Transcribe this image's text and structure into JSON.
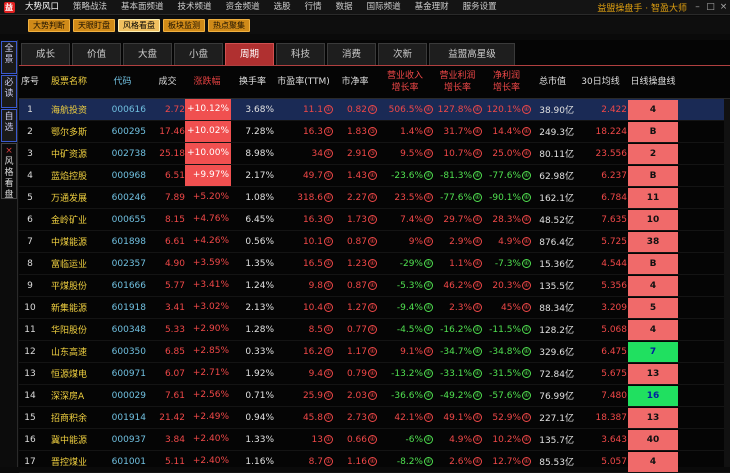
{
  "menubar": {
    "logo": "益",
    "items": [
      "大势风口",
      "策略战法",
      "基本面频道",
      "技术频道",
      "资金频道",
      "选股",
      "行情",
      "数据",
      "国际频道",
      "基金理财",
      "服务设置"
    ],
    "brand": "益盟操盘手 · 智盈大师",
    "minimize": "–",
    "maximize": "□",
    "close": "×"
  },
  "subbar": {
    "buttons": [
      "大势判断",
      "天眼盯盘",
      "风格看盘",
      "板块监测",
      "热点聚集"
    ],
    "selected_index": 2
  },
  "sidebar": {
    "tab1": "全景",
    "tab2": "必读",
    "tab3": "自选",
    "tab4_close": "×",
    "tab4": "风格看盘"
  },
  "tabs": [
    "成长",
    "价值",
    "大盘",
    "小盘",
    "周期",
    "科技",
    "消费",
    "次新",
    "益盟高星级"
  ],
  "selected_tab": 4,
  "columns": {
    "idx": "序号",
    "name": "股票名称",
    "code": "代码",
    "price": "成交",
    "change": "涨跌幅",
    "turnover": "换手率",
    "pe": "市盈率(TTM)",
    "pb": "市净率",
    "rev1": "营业收入",
    "rev2": "增长率",
    "np1": "营业利润",
    "np2": "增长率",
    "nr1": "净利润",
    "nr2": "增长率",
    "mcap": "总市值",
    "ma30": "30日均线",
    "op": "日线操盘线"
  },
  "colors": {
    "up": "#f04848",
    "down": "#50e050",
    "tab_selected": "#b03030",
    "highlight_cell": "#f05050",
    "green_box": "#20e060"
  },
  "rows": [
    {
      "idx": "1",
      "name": "海航投资",
      "code": "000616",
      "price": "2.72",
      "change": "+10.12%",
      "lim": true,
      "turnover": "3.68%",
      "pe": "11.1",
      "pe_r": "①",
      "pb": "0.82",
      "pb_r": "④",
      "rev": "506.5%",
      "rev_r": "④",
      "np": "127.8%",
      "np_r": "④",
      "nr": "120.1%",
      "nr_r": "④",
      "mcap": "38.90亿",
      "ma30": "2.422",
      "op": "4",
      "opc": "red",
      "revdn": false,
      "npdn": false,
      "nrdn": false
    },
    {
      "idx": "2",
      "name": "鄂尔多斯",
      "code": "600295",
      "price": "17.46",
      "change": "+10.02%",
      "lim": true,
      "turnover": "7.28%",
      "pe": "16.3",
      "pe_r": "①",
      "pb": "1.83",
      "pb_r": "③",
      "rev": "1.4%",
      "rev_r": "④",
      "np": "31.7%",
      "np_r": "④",
      "nr": "14.4%",
      "nr_r": "④",
      "mcap": "249.3亿",
      "ma30": "18.224",
      "op": "B",
      "opc": "red",
      "revdn": false,
      "npdn": false,
      "nrdn": false
    },
    {
      "idx": "3",
      "name": "中矿资源",
      "code": "002738",
      "price": "25.18",
      "change": "+10.00%",
      "lim": true,
      "turnover": "8.98%",
      "pe": "34",
      "pe_r": "①",
      "pb": "2.91",
      "pb_r": "③",
      "rev": "9.5%",
      "rev_r": "④",
      "np": "10.7%",
      "np_r": "④",
      "nr": "25.0%",
      "nr_r": "④",
      "mcap": "80.11亿",
      "ma30": "23.556",
      "op": "2",
      "opc": "red",
      "revdn": false,
      "npdn": false,
      "nrdn": false
    },
    {
      "idx": "4",
      "name": "蓝焰控股",
      "code": "000968",
      "price": "6.51",
      "change": "+9.97%",
      "lim": true,
      "turnover": "2.17%",
      "pe": "49.7",
      "pe_r": "①",
      "pb": "1.43",
      "pb_r": "④",
      "rev": "-23.6%",
      "rev_r": "④",
      "np": "-81.3%",
      "np_r": "④",
      "nr": "-77.6%",
      "nr_r": "④",
      "mcap": "62.98亿",
      "ma30": "6.237",
      "op": "B",
      "opc": "red",
      "revdn": true,
      "npdn": true,
      "nrdn": true
    },
    {
      "idx": "5",
      "name": "万通发展",
      "code": "600246",
      "price": "7.89",
      "change": "+5.20%",
      "lim": false,
      "turnover": "1.08%",
      "pe": "318.6",
      "pe_r": "④",
      "pb": "2.27",
      "pb_r": "④",
      "rev": "23.5%",
      "rev_r": "④",
      "np": "-77.6%",
      "np_r": "④",
      "nr": "-90.1%",
      "nr_r": "④",
      "mcap": "162.1亿",
      "ma30": "6.784",
      "op": "11",
      "opc": "red",
      "revdn": false,
      "npdn": true,
      "nrdn": true
    },
    {
      "idx": "6",
      "name": "金岭矿业",
      "code": "000655",
      "price": "8.15",
      "change": "+4.76%",
      "lim": false,
      "turnover": "6.45%",
      "pe": "16.3",
      "pe_r": "①",
      "pb": "1.73",
      "pb_r": "④",
      "rev": "7.4%",
      "rev_r": "④",
      "np": "29.7%",
      "np_r": "④",
      "nr": "28.3%",
      "nr_r": "④",
      "mcap": "48.52亿",
      "ma30": "7.635",
      "op": "10",
      "opc": "red",
      "revdn": false,
      "npdn": false,
      "nrdn": false
    },
    {
      "idx": "7",
      "name": "中煤能源",
      "code": "601898",
      "price": "6.61",
      "change": "+4.26%",
      "lim": false,
      "turnover": "0.56%",
      "pe": "10.1",
      "pe_r": "①",
      "pb": "0.87",
      "pb_r": "④",
      "rev": "9%",
      "rev_r": "④",
      "np": "2.9%",
      "np_r": "④",
      "nr": "4.9%",
      "nr_r": "④",
      "mcap": "876.4亿",
      "ma30": "5.725",
      "op": "38",
      "opc": "red",
      "revdn": false,
      "npdn": false,
      "nrdn": false
    },
    {
      "idx": "8",
      "name": "富临运业",
      "code": "002357",
      "price": "4.90",
      "change": "+3.59%",
      "lim": false,
      "turnover": "1.35%",
      "pe": "16.5",
      "pe_r": "①",
      "pb": "1.23",
      "pb_r": "④",
      "rev": "-29%",
      "rev_r": "④",
      "np": "1.1%",
      "np_r": "④",
      "nr": "-7.3%",
      "nr_r": "④",
      "mcap": "15.36亿",
      "ma30": "4.544",
      "op": "B",
      "opc": "red",
      "revdn": true,
      "npdn": false,
      "nrdn": true
    },
    {
      "idx": "9",
      "name": "平煤股份",
      "code": "601666",
      "price": "5.77",
      "change": "+3.41%",
      "lim": false,
      "turnover": "1.24%",
      "pe": "9.8",
      "pe_r": "①",
      "pb": "0.87",
      "pb_r": "④",
      "rev": "-5.3%",
      "rev_r": "④",
      "np": "46.2%",
      "np_r": "④",
      "nr": "20.3%",
      "nr_r": "④",
      "mcap": "135.5亿",
      "ma30": "5.356",
      "op": "4",
      "opc": "red",
      "revdn": true,
      "npdn": false,
      "nrdn": false
    },
    {
      "idx": "10",
      "name": "新集能源",
      "code": "601918",
      "price": "3.41",
      "change": "+3.02%",
      "lim": false,
      "turnover": "2.13%",
      "pe": "10.4",
      "pe_r": "①",
      "pb": "1.27",
      "pb_r": "④",
      "rev": "-9.4%",
      "rev_r": "④",
      "np": "2.3%",
      "np_r": "④",
      "nr": "45%",
      "nr_r": "④",
      "mcap": "88.34亿",
      "ma30": "3.209",
      "op": "5",
      "opc": "red",
      "revdn": true,
      "npdn": false,
      "nrdn": false
    },
    {
      "idx": "11",
      "name": "华阳股份",
      "code": "600348",
      "price": "5.33",
      "change": "+2.90%",
      "lim": false,
      "turnover": "1.28%",
      "pe": "8.5",
      "pe_r": "①",
      "pb": "0.77",
      "pb_r": "④",
      "rev": "-4.5%",
      "rev_r": "④",
      "np": "-16.2%",
      "np_r": "④",
      "nr": "-11.5%",
      "nr_r": "④",
      "mcap": "128.2亿",
      "ma30": "5.068",
      "op": "4",
      "opc": "red",
      "revdn": true,
      "npdn": true,
      "nrdn": true
    },
    {
      "idx": "12",
      "name": "山东高速",
      "code": "600350",
      "price": "6.85",
      "change": "+2.85%",
      "lim": false,
      "turnover": "0.33%",
      "pe": "16.2",
      "pe_r": "④",
      "pb": "1.17",
      "pb_r": "④",
      "rev": "9.1%",
      "rev_r": "④",
      "np": "-34.7%",
      "np_r": "④",
      "nr": "-34.8%",
      "nr_r": "④",
      "mcap": "329.6亿",
      "ma30": "6.475",
      "op": "7",
      "opc": "green",
      "revdn": false,
      "npdn": true,
      "nrdn": true
    },
    {
      "idx": "13",
      "name": "恒源煤电",
      "code": "600971",
      "price": "6.07",
      "change": "+2.71%",
      "lim": false,
      "turnover": "1.92%",
      "pe": "9.4",
      "pe_r": "①",
      "pb": "0.79",
      "pb_r": "④",
      "rev": "-13.2%",
      "rev_r": "④",
      "np": "-33.1%",
      "np_r": "④",
      "nr": "-31.5%",
      "nr_r": "④",
      "mcap": "72.84亿",
      "ma30": "5.675",
      "op": "13",
      "opc": "red",
      "revdn": true,
      "npdn": true,
      "nrdn": true
    },
    {
      "idx": "14",
      "name": "深深房A",
      "code": "000029",
      "price": "7.61",
      "change": "+2.56%",
      "lim": false,
      "turnover": "0.71%",
      "pe": "25.9",
      "pe_r": "①",
      "pb": "2.03",
      "pb_r": "④",
      "rev": "-36.6%",
      "rev_r": "④",
      "np": "-49.2%",
      "np_r": "④",
      "nr": "-57.6%",
      "nr_r": "④",
      "mcap": "76.99亿",
      "ma30": "7.480",
      "op": "16",
      "opc": "green",
      "revdn": true,
      "npdn": true,
      "nrdn": true
    },
    {
      "idx": "15",
      "name": "招商积余",
      "code": "001914",
      "price": "21.42",
      "change": "+2.49%",
      "lim": false,
      "turnover": "0.94%",
      "pe": "45.8",
      "pe_r": "①",
      "pb": "2.73",
      "pb_r": "④",
      "rev": "42.1%",
      "rev_r": "④",
      "np": "49.1%",
      "np_r": "④",
      "nr": "52.9%",
      "nr_r": "④",
      "mcap": "227.1亿",
      "ma30": "18.387",
      "op": "13",
      "opc": "red",
      "revdn": false,
      "npdn": false,
      "nrdn": false
    },
    {
      "idx": "16",
      "name": "冀中能源",
      "code": "000937",
      "price": "3.84",
      "change": "+2.40%",
      "lim": false,
      "turnover": "1.33%",
      "pe": "13",
      "pe_r": "①",
      "pb": "0.66",
      "pb_r": "④",
      "rev": "-6%",
      "rev_r": "④",
      "np": "4.9%",
      "np_r": "④",
      "nr": "10.2%",
      "nr_r": "④",
      "mcap": "135.7亿",
      "ma30": "3.643",
      "op": "40",
      "opc": "red",
      "revdn": true,
      "npdn": false,
      "nrdn": false
    },
    {
      "idx": "17",
      "name": "晋控煤业",
      "code": "601001",
      "price": "5.11",
      "change": "+2.40%",
      "lim": false,
      "turnover": "1.16%",
      "pe": "8.7",
      "pe_r": "①",
      "pb": "1.16",
      "pb_r": "④",
      "rev": "-8.2%",
      "rev_r": "④",
      "np": "2.6%",
      "np_r": "④",
      "nr": "12.7%",
      "nr_r": "④",
      "mcap": "85.53亿",
      "ma30": "5.057",
      "op": "4",
      "opc": "red",
      "revdn": true,
      "npdn": false,
      "nrdn": false
    }
  ]
}
